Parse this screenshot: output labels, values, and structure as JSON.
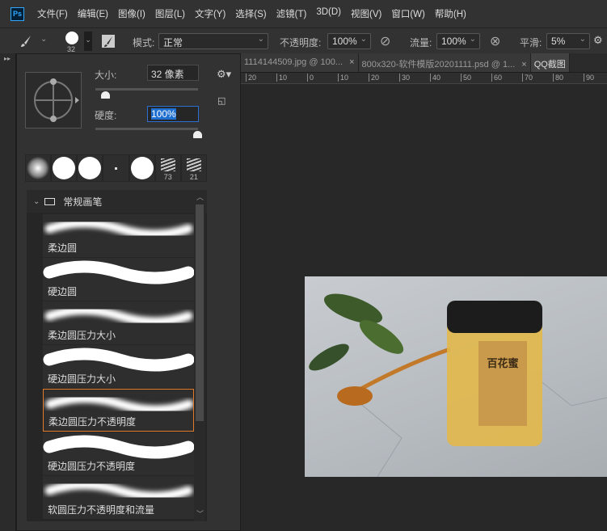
{
  "app": {
    "logo": "Ps"
  },
  "menu": [
    "文件(F)",
    "编辑(E)",
    "图像(I)",
    "图层(L)",
    "文字(Y)",
    "选择(S)",
    "滤镜(T)",
    "3D(D)",
    "视图(V)",
    "窗口(W)",
    "帮助(H)"
  ],
  "options": {
    "brush_size": "32",
    "mode_label": "模式:",
    "mode_value": "正常",
    "opacity_label": "不透明度:",
    "opacity_value": "100%",
    "flow_label": "流量:",
    "flow_value": "100%",
    "smooth_label": "平滑:",
    "smooth_value": "5%"
  },
  "tabs": [
    {
      "label": "1114144509.jpg @ 100...",
      "close": "×"
    },
    {
      "label": "800x320-软件模版20201111.psd @ 1...",
      "close": "×"
    },
    {
      "label": "QQ截图"
    }
  ],
  "ruler": [
    "20",
    "10",
    "0",
    "10",
    "20",
    "30",
    "40",
    "50",
    "60",
    "70",
    "80",
    "90"
  ],
  "brush_panel": {
    "size_label": "大小:",
    "size_value": "32 像素",
    "hardness_label": "硬度:",
    "hardness_value": "100%",
    "size_fraction": 0.1,
    "hardness_fraction": 1.0,
    "presets": [
      {
        "type": "soft"
      },
      {
        "type": "hard"
      },
      {
        "type": "hard"
      },
      {
        "type": "dot"
      },
      {
        "type": "hard"
      },
      {
        "type": "texture",
        "count": "73"
      },
      {
        "type": "texture2",
        "count": "21"
      }
    ],
    "group": "常规画笔",
    "brushes": [
      {
        "name": "柔边圆",
        "soft": true
      },
      {
        "name": "硬边圆",
        "soft": false
      },
      {
        "name": "柔边圆压力大小",
        "soft": true
      },
      {
        "name": "硬边圆压力大小",
        "soft": false
      },
      {
        "name": "柔边圆压力不透明度",
        "soft": true,
        "selected": true
      },
      {
        "name": "硬边圆压力不透明度",
        "soft": false
      },
      {
        "name": "软圆压力不透明度和流量",
        "soft": true
      }
    ]
  },
  "photo": {
    "label_text": "百花蜜"
  },
  "colors": {
    "accent": "#e07b2c",
    "selection": "#1f6fd1",
    "ps_blue": "#31a8ff"
  }
}
